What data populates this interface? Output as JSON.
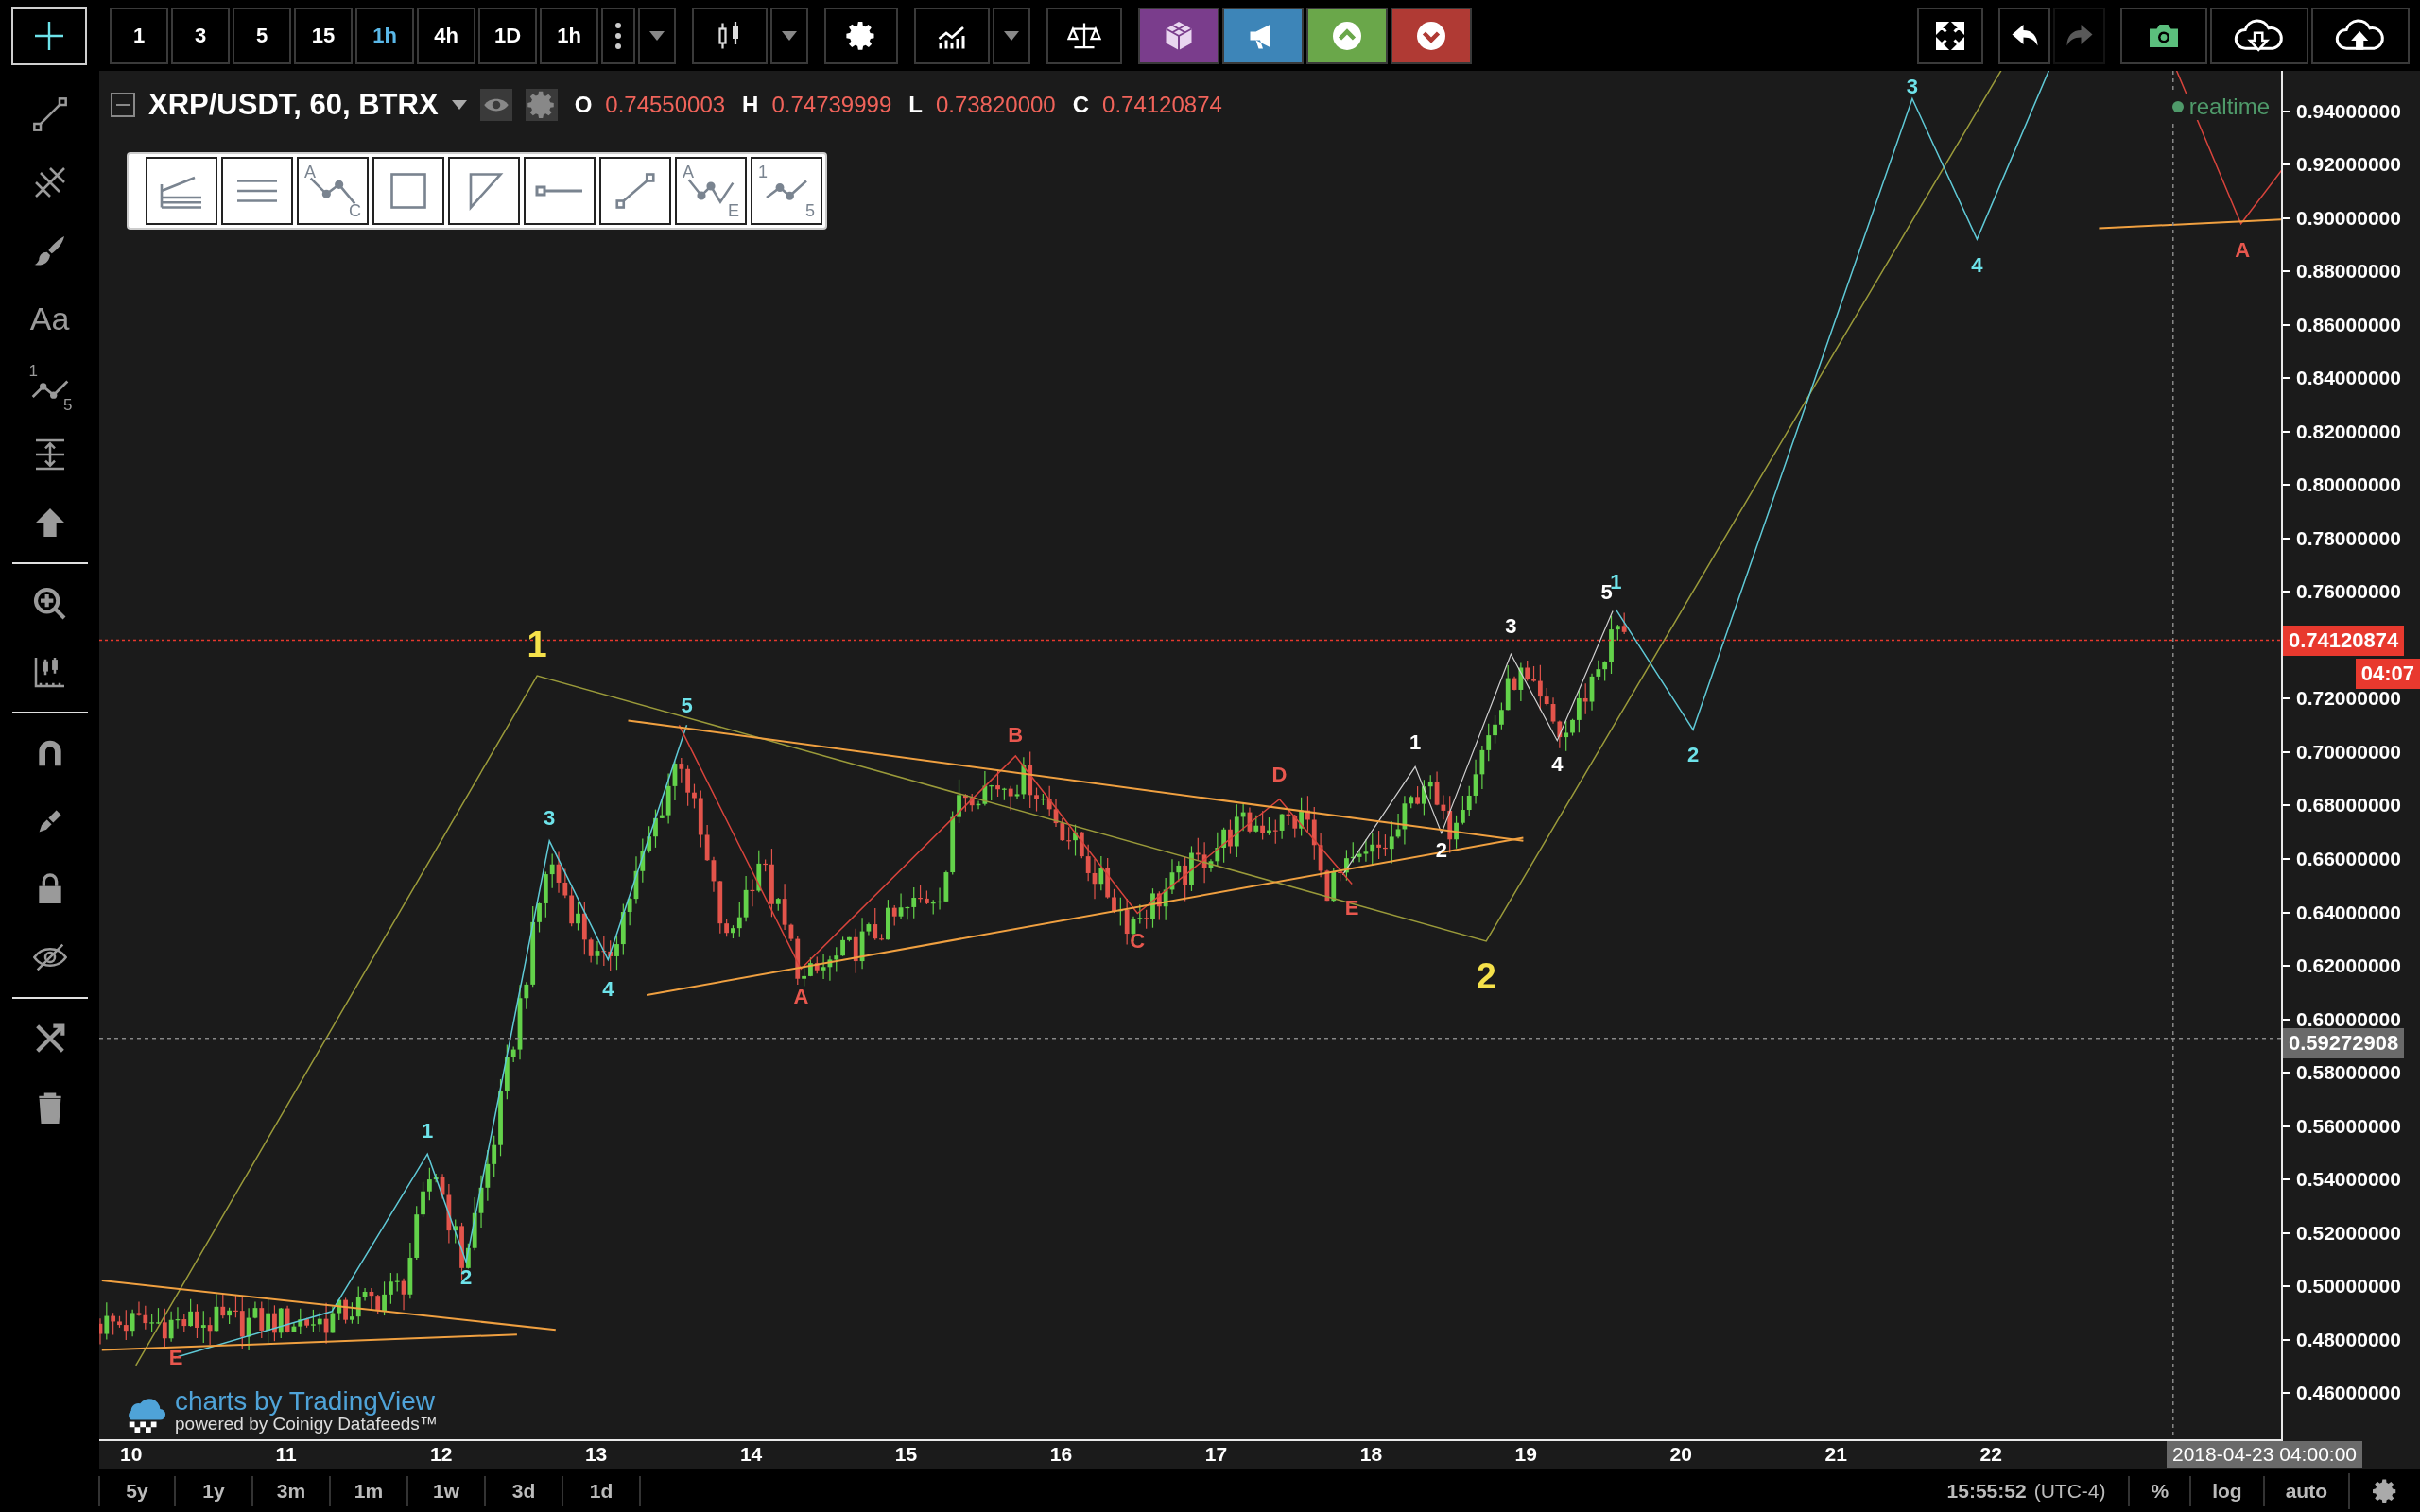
{
  "top_toolbar": {
    "cursor_selected": true,
    "intervals": [
      {
        "label": "1",
        "selected": false
      },
      {
        "label": "3",
        "selected": false
      },
      {
        "label": "5",
        "selected": false
      },
      {
        "label": "15",
        "selected": false
      },
      {
        "label": "1h",
        "selected": true
      },
      {
        "label": "4h",
        "selected": false
      },
      {
        "label": "1D",
        "selected": false
      },
      {
        "label": "1h",
        "selected": false
      }
    ],
    "undo_disabled": false,
    "redo_disabled": true
  },
  "sidebar": {
    "text_tool_label": "Aa",
    "wave_tool_marks": [
      "1",
      "5"
    ]
  },
  "chart_header": {
    "symbol": "XRP/USDT, 60, BTRX",
    "ohlc": [
      {
        "key": "O",
        "value": "0.74550003"
      },
      {
        "key": "H",
        "value": "0.74739999"
      },
      {
        "key": "L",
        "value": "0.73820000"
      },
      {
        "key": "C",
        "value": "0.74120874"
      }
    ]
  },
  "drawing_toolbar": {
    "abc_marks": [
      "A",
      "C"
    ],
    "abcde_marks": [
      "A",
      "E"
    ],
    "impulse_marks": [
      "1",
      "5"
    ]
  },
  "status": "realtime",
  "wave_labels": [
    {
      "text": "1",
      "color": "#f5e14a"
    },
    {
      "text": "2",
      "color": "#f5e14a"
    },
    {
      "text": "1",
      "color": "#6ee3ea"
    },
    {
      "text": "2",
      "color": "#6ee3ea"
    },
    {
      "text": "3",
      "color": "#6ee3ea"
    },
    {
      "text": "4",
      "color": "#6ee3ea"
    },
    {
      "text": "5",
      "color": "#6ee3ea"
    },
    {
      "text": "3",
      "color": "#6ee3ea"
    },
    {
      "text": "4",
      "color": "#6ee3ea"
    },
    {
      "text": "2",
      "color": "#6ee3ea"
    },
    {
      "text": "1",
      "color": "#6ee3ea"
    },
    {
      "text": "A",
      "color": "#e8574e"
    },
    {
      "text": "B",
      "color": "#e8574e"
    },
    {
      "text": "C",
      "color": "#e8574e"
    },
    {
      "text": "D",
      "color": "#e8574e"
    },
    {
      "text": "E",
      "color": "#e8574e"
    },
    {
      "text": "E",
      "color": "#e8574e"
    },
    {
      "text": "A",
      "color": "#e8574e"
    },
    {
      "text": "1",
      "color": "#ffffff"
    },
    {
      "text": "2",
      "color": "#ffffff"
    },
    {
      "text": "3",
      "color": "#ffffff"
    },
    {
      "text": "4",
      "color": "#ffffff"
    },
    {
      "text": "5",
      "color": "#ffffff"
    }
  ],
  "branding": {
    "title": "charts by TradingView",
    "subtitle": "powered by Coinigy Datafeeds™"
  },
  "price_axis": {
    "ticks": [
      "0.94000000",
      "0.92000000",
      "0.90000000",
      "0.88000000",
      "0.86000000",
      "0.84000000",
      "0.82000000",
      "0.80000000",
      "0.78000000",
      "0.76000000",
      "0.72000000",
      "0.70000000",
      "0.68000000",
      "0.66000000",
      "0.64000000",
      "0.62000000",
      "0.60000000",
      "0.58000000",
      "0.56000000",
      "0.54000000",
      "0.52000000",
      "0.50000000",
      "0.48000000",
      "0.46000000"
    ],
    "last_price": "0.74120874",
    "countdown": "04:07",
    "crosshair_price": "0.59272908"
  },
  "time_axis": {
    "ticks": [
      "10",
      "11",
      "12",
      "13",
      "14",
      "15",
      "16",
      "17",
      "18",
      "19",
      "20",
      "21",
      "22"
    ],
    "crosshair_time": "2018-04-23 04:00:00"
  },
  "bottom_bar": {
    "ranges": [
      "5y",
      "1y",
      "3m",
      "1m",
      "1w",
      "3d",
      "1d"
    ],
    "clock": "15:55:52",
    "timezone": "(UTC-4)",
    "percent": "%",
    "log": "log",
    "auto": "auto"
  }
}
